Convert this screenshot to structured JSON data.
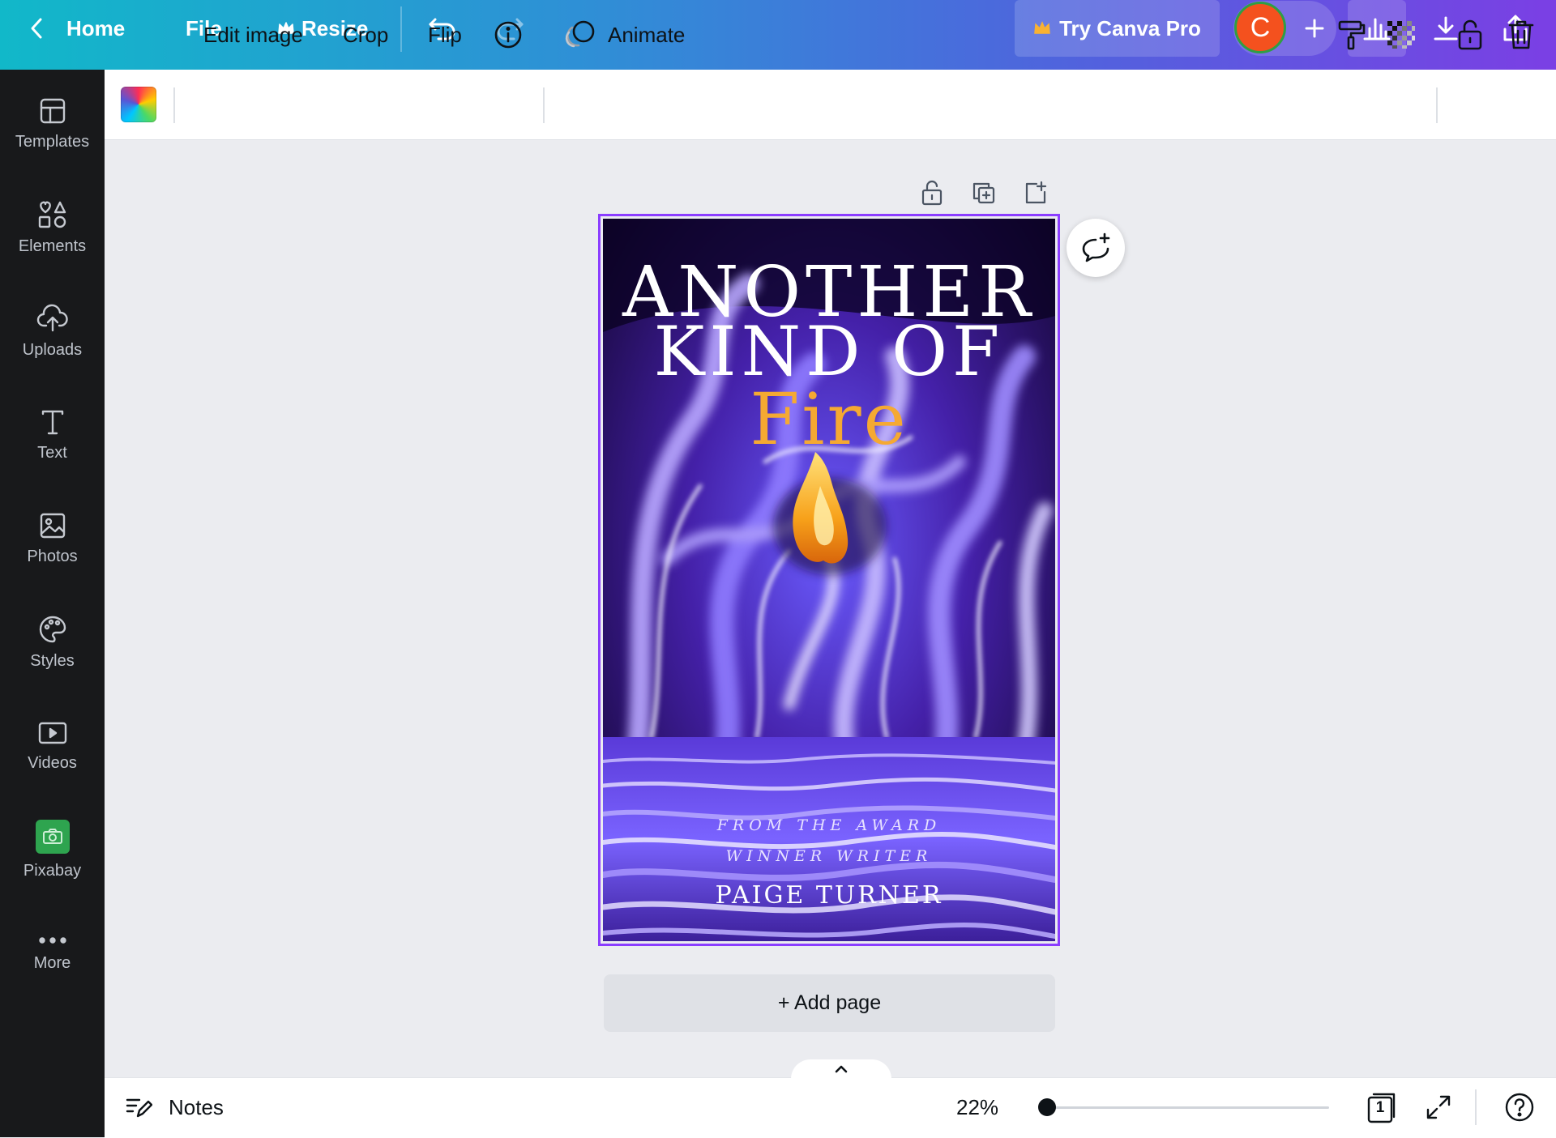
{
  "topbar": {
    "home_label": "Home",
    "file_label": "File",
    "resize_label": "Resize",
    "pro_label": "Try Canva Pro",
    "avatar_initial": "C"
  },
  "sidebar": {
    "items": [
      {
        "label": "Templates",
        "icon": "templates-icon"
      },
      {
        "label": "Elements",
        "icon": "elements-icon"
      },
      {
        "label": "Uploads",
        "icon": "uploads-icon"
      },
      {
        "label": "Text",
        "icon": "text-icon"
      },
      {
        "label": "Photos",
        "icon": "photos-icon"
      },
      {
        "label": "Styles",
        "icon": "styles-icon"
      },
      {
        "label": "Videos",
        "icon": "videos-icon"
      },
      {
        "label": "Pixabay",
        "icon": "pixabay-icon"
      },
      {
        "label": "More",
        "icon": "more-icon"
      }
    ]
  },
  "toolbar": {
    "edit_image_label": "Edit image",
    "crop_label": "Crop",
    "flip_label": "Flip",
    "animate_label": "Animate"
  },
  "design": {
    "title_line1": "ANOTHER",
    "title_line2": "KIND OF",
    "title_line3": "Fire",
    "subtitle_line1": "FROM THE AWARD",
    "subtitle_line2": "WINNER WRITER",
    "author": "PAIGE TURNER"
  },
  "canvas": {
    "add_page_label": "+ Add page"
  },
  "bottombar": {
    "notes_label": "Notes",
    "zoom_label": "22%",
    "zoom_fraction": 0.0,
    "page_count": "1"
  },
  "colors": {
    "selection": "#8b3dff",
    "title_accent": "#f5a932",
    "avatar": "#f4511e",
    "pro_crown": "#f9b233"
  }
}
